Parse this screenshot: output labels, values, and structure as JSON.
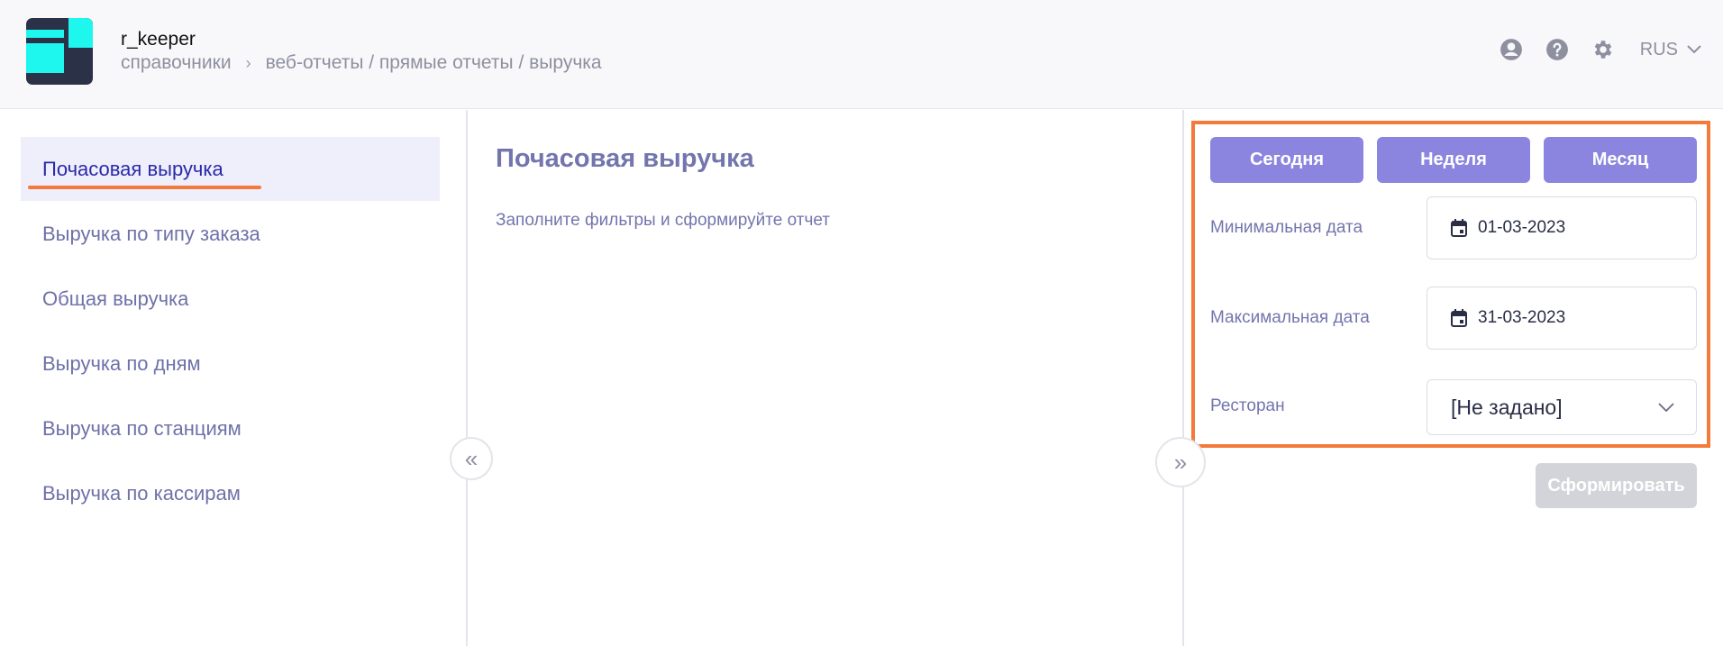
{
  "header": {
    "app_name": "r_keeper",
    "breadcrumb": {
      "root": "справочники",
      "separator": "›",
      "path": "веб-отчеты / прямые отчеты / выручка"
    },
    "icons": [
      "user-circle-icon",
      "help-circle-icon",
      "gear-icon"
    ],
    "language": "RUS"
  },
  "sidebar": {
    "items": [
      {
        "label": "Почасовая выручка",
        "active": true
      },
      {
        "label": "Выручка по типу заказа",
        "active": false
      },
      {
        "label": "Общая выручка",
        "active": false
      },
      {
        "label": "Выручка по дням",
        "active": false
      },
      {
        "label": "Выручка по станциям",
        "active": false
      },
      {
        "label": "Выручка по кассирам",
        "active": false
      }
    ]
  },
  "main": {
    "title": "Почасовая выручка",
    "hint": "Заполните фильтры и сформируйте отчет",
    "collapse_left": "«",
    "collapse_right": "»"
  },
  "filters": {
    "quick": {
      "today": "Сегодня",
      "week": "Неделя",
      "month": "Месяц"
    },
    "min_date": {
      "label": "Минимальная дата",
      "value": "01-03-2023"
    },
    "max_date": {
      "label": "Максимальная дата",
      "value": "31-03-2023"
    },
    "restaurant": {
      "label": "Ресторан",
      "value": "[Не задано]"
    },
    "submit": "Сформировать"
  },
  "colors": {
    "accent": "#8b85df",
    "highlight": "#f47a3b",
    "logo_cyan": "#1ef7ee",
    "logo_dark": "#2b3147",
    "active_bg": "#efeefb",
    "active_text": "#2a2aa8",
    "muted_text": "#7375ad",
    "disabled_button": "#d3d4d9"
  }
}
